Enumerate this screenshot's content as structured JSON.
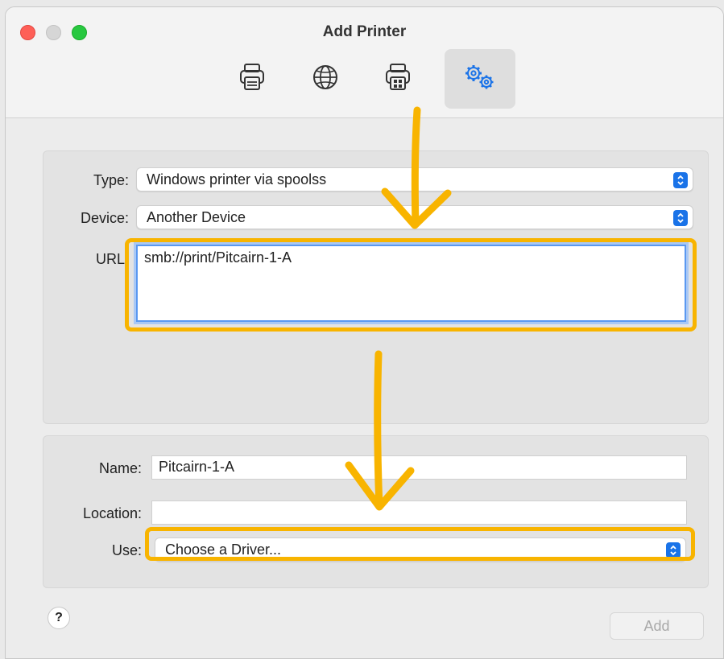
{
  "window": {
    "title": "Add Printer"
  },
  "toolbar": {
    "items": [
      {
        "icon": "printer-icon",
        "active": false
      },
      {
        "icon": "globe-icon",
        "active": false
      },
      {
        "icon": "windows-printer-icon",
        "active": false
      },
      {
        "icon": "gears-icon",
        "active": true
      }
    ]
  },
  "form": {
    "type_label": "Type:",
    "type_value": "Windows printer via spoolss",
    "device_label": "Device:",
    "device_value": "Another Device",
    "url_label": "URL:",
    "url_value": "smb://print/Pitcairn-1-A",
    "name_label": "Name:",
    "name_value": "Pitcairn-1-A",
    "location_label": "Location:",
    "location_value": "",
    "use_label": "Use:",
    "use_value": "Choose a Driver..."
  },
  "footer": {
    "help_label": "?",
    "add_label": "Add"
  },
  "colors": {
    "annotation": "#f8b400",
    "accent": "#1a73e8",
    "close": "#fe5f57",
    "zoom": "#28c840"
  }
}
